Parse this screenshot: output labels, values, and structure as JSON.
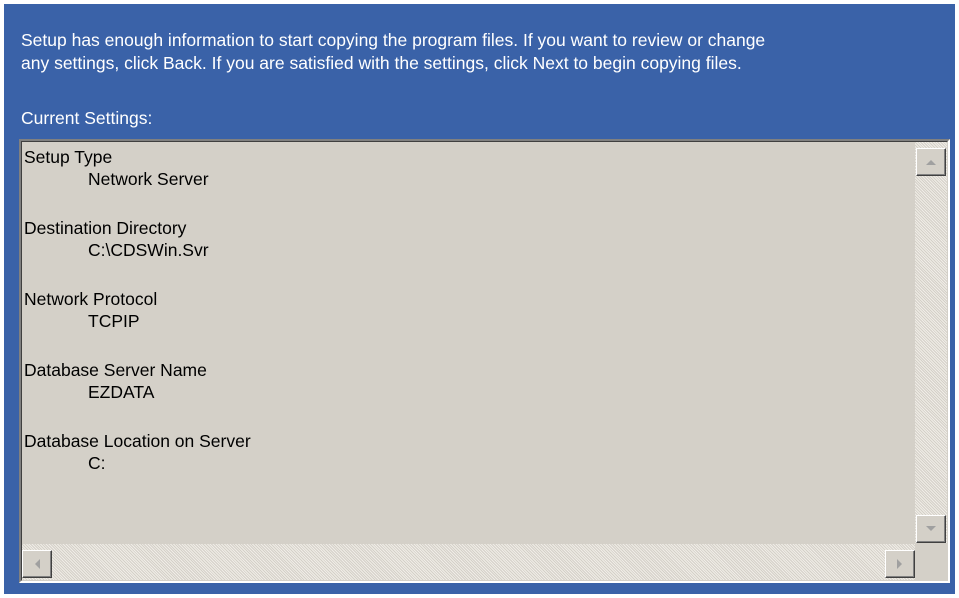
{
  "instructions": {
    "text": "Setup has enough information to start copying the program files.  If you want to review or change\nany settings, click Back.  If you are satisfied with the settings, click Next to begin copying files."
  },
  "current_settings": {
    "label": "Current Settings:",
    "entries": [
      {
        "label": "Setup Type",
        "value": "Network Server"
      },
      {
        "label": "Destination Directory",
        "value": "C:\\CDSWin.Svr"
      },
      {
        "label": "Network Protocol",
        "value": "TCPIP"
      },
      {
        "label": "Database Server Name",
        "value": "EZDATA"
      },
      {
        "label": "Database Location on Server",
        "value": "C:"
      }
    ]
  },
  "colors": {
    "panel_background": "#3a62a8",
    "listbox_background": "#d4d0c8",
    "text_on_panel": "#ffffff",
    "text_in_listbox": "#000000"
  },
  "icons": {
    "scroll_up": "arrow-up-icon",
    "scroll_down": "arrow-down-icon",
    "scroll_left": "arrow-left-icon",
    "scroll_right": "arrow-right-icon"
  }
}
